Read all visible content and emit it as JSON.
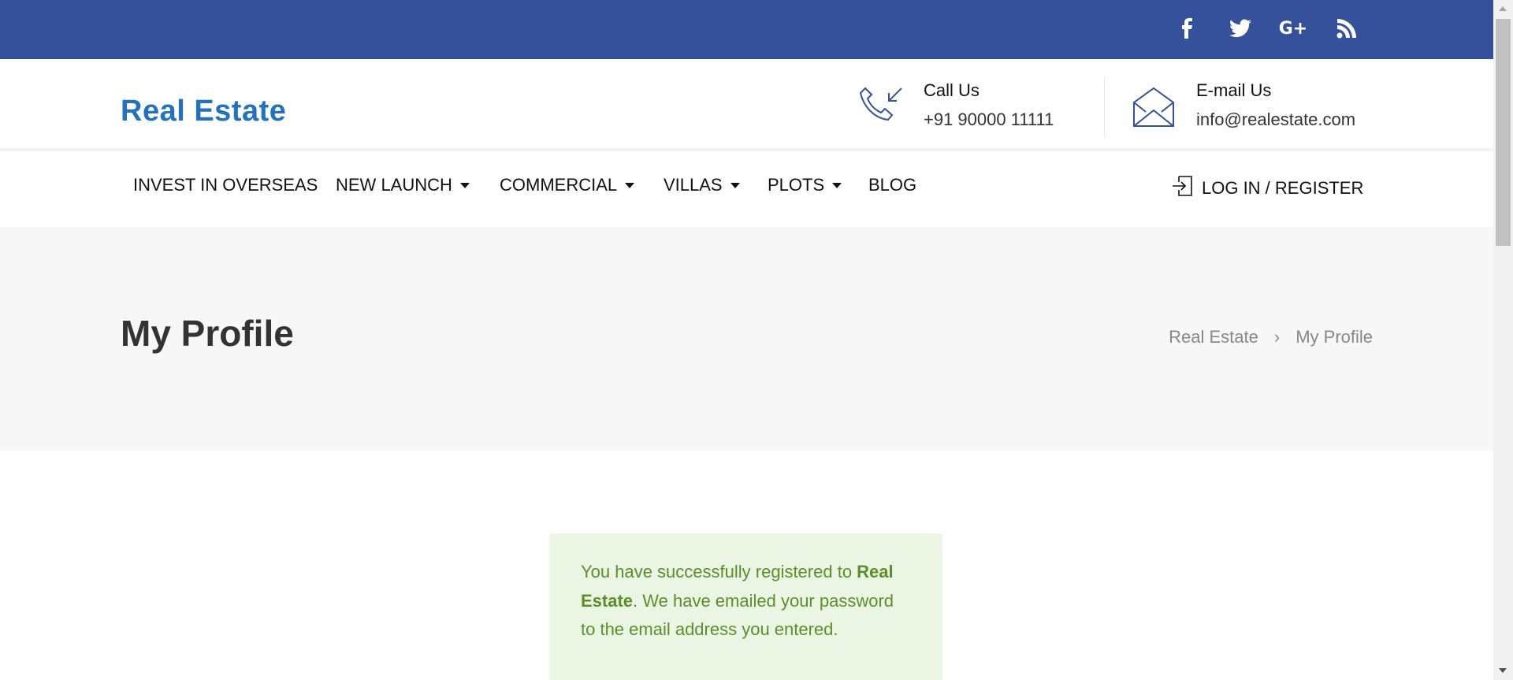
{
  "topbar": {
    "color": "#36519b",
    "social": [
      {
        "icon": "facebook-icon",
        "glyph": "f"
      },
      {
        "icon": "twitter-icon",
        "glyph": "t"
      },
      {
        "icon": "google-plus-icon",
        "glyph": "G+"
      },
      {
        "icon": "rss-icon",
        "glyph": "rss"
      }
    ]
  },
  "header": {
    "logo": "Real Estate",
    "call_label": "Call Us",
    "call_value": "+91 90000 11111",
    "email_label": "E-mail Us",
    "email_value": "info@realestate.com"
  },
  "nav": {
    "items": [
      {
        "label": "INVEST IN OVERSEAS"
      },
      {
        "label": "NEW LAUNCH"
      },
      {
        "label": "COMMERCIAL"
      },
      {
        "label": "VILLAS"
      },
      {
        "label": "PLOTS"
      },
      {
        "label": "BLOG"
      }
    ],
    "login": "LOG IN / REGISTER"
  },
  "page": {
    "title": "My Profile",
    "breadcrumb": [
      "Real Estate",
      "My Profile"
    ],
    "breadcrumb_sep": "›"
  },
  "alert": {
    "pre": "You have successfully registered to ",
    "bold": "Real Estate",
    "post": ". We have emailed your password to the email address you entered.",
    "color": "#5a8f2a",
    "bg": "#ebf5e3"
  }
}
